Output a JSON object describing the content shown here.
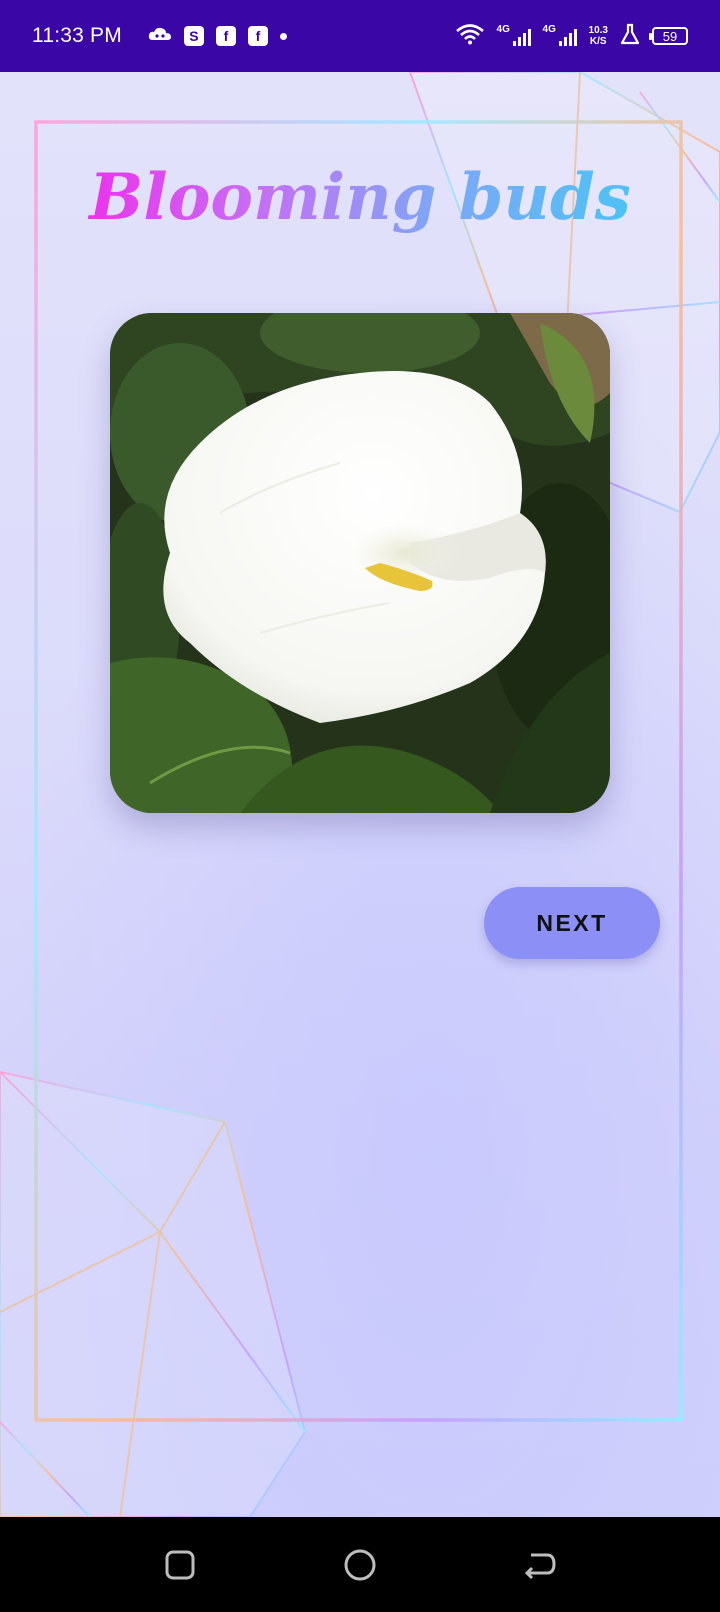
{
  "status_bar": {
    "time": "11:33 PM",
    "left_icons": [
      "cloud-game-icon",
      "shopee-bag-icon",
      "facebook-icon",
      "facebook-icon",
      "more-dot-icon"
    ],
    "network_1": "4G",
    "network_2": "4G",
    "speed_value": "10.3",
    "speed_unit": "K/S",
    "battery": "59"
  },
  "app": {
    "title": "Blooming buds",
    "title_gradient": [
      "#ff14e8",
      "#c86cf5",
      "#7fa6f5",
      "#36d0f5"
    ],
    "image": "white-calla-lily",
    "next_label": "NEXT",
    "next_color": "#8c8ff5"
  },
  "nav_bar": {
    "buttons": [
      "recent-apps-icon",
      "home-icon",
      "back-icon"
    ]
  }
}
